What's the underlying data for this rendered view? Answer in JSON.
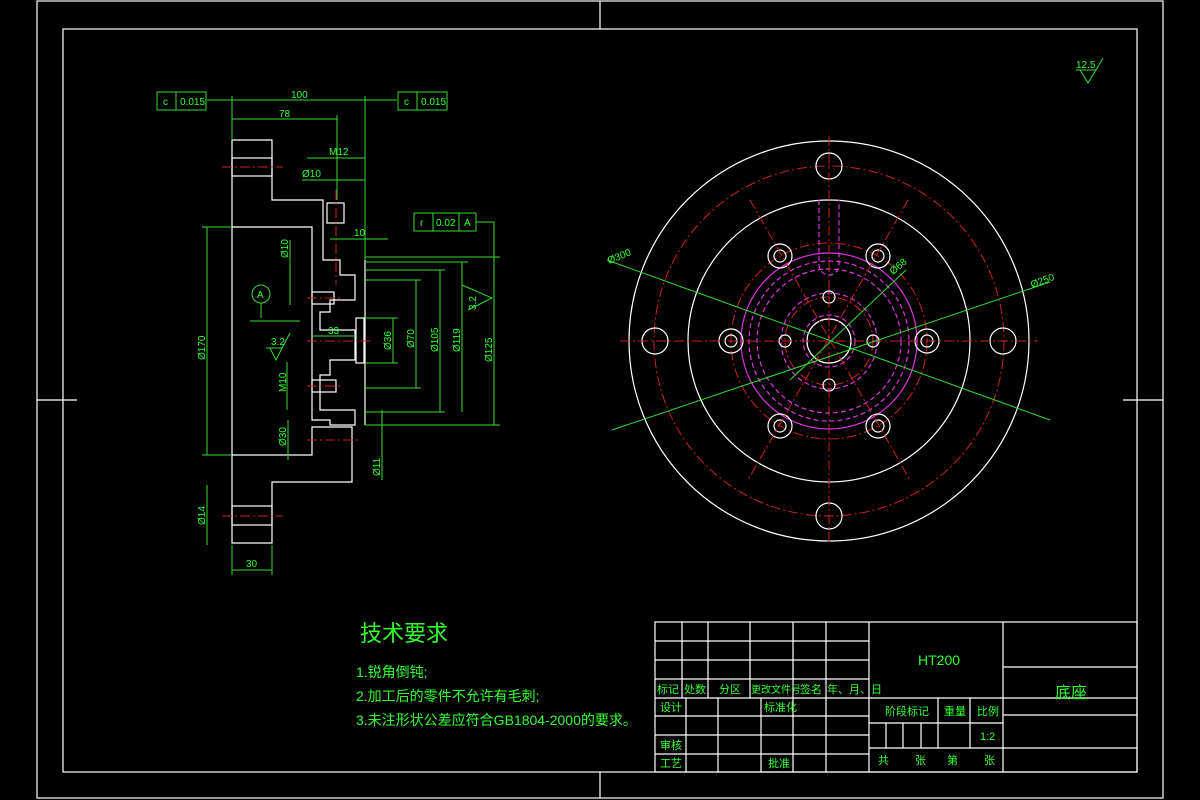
{
  "drawing": {
    "roughness_general": "12.5",
    "section_view": {
      "dimensions": [
        "100",
        "78",
        "M12",
        "Ø10",
        "10",
        "Ø10",
        "33",
        "Ø36",
        "Ø70",
        "Ø105",
        "Ø119",
        "Ø125",
        "Ø30",
        "Ø11",
        "Ø14",
        "30",
        "M10",
        "Ø170"
      ],
      "roughness": [
        "3.2",
        "3.2"
      ],
      "datum": "A",
      "tolerance_frames": [
        {
          "symbol": "c",
          "value": "0.015"
        },
        {
          "symbol": "c",
          "value": "0.015"
        },
        {
          "symbol": "r",
          "value": "0.02",
          "datum": "A"
        }
      ]
    },
    "front_view": {
      "dimensions": [
        "Ø300",
        "Ø68",
        "Ø250"
      ]
    },
    "colors": {
      "outline": "#ffffff",
      "dimension": "#33dd33",
      "centerline": "#cc2222",
      "hidden": "#dd33dd",
      "hatch": "#66dddd"
    }
  },
  "tech_requirements": {
    "title": "技术要求",
    "items": [
      "1.锐角倒钝;",
      "2.加工后的零件不允许有毛刺;",
      "3.未注形状公差应符合GB1804-2000的要求。"
    ]
  },
  "title_block": {
    "material": "HT200",
    "part_name": "底座",
    "scale": "1:2",
    "headers": [
      "标记",
      "处数",
      "分区",
      "更改文件号",
      "签名",
      "年、月、日"
    ],
    "design": "设计",
    "standardization": "标准化",
    "review": "审核",
    "process": "工艺",
    "approve": "批准",
    "stage_mark": "阶段标记",
    "weight": "重量",
    "scale_label": "比例",
    "total": "共",
    "sheets": "张",
    "page": "第",
    "sheet": "张"
  }
}
